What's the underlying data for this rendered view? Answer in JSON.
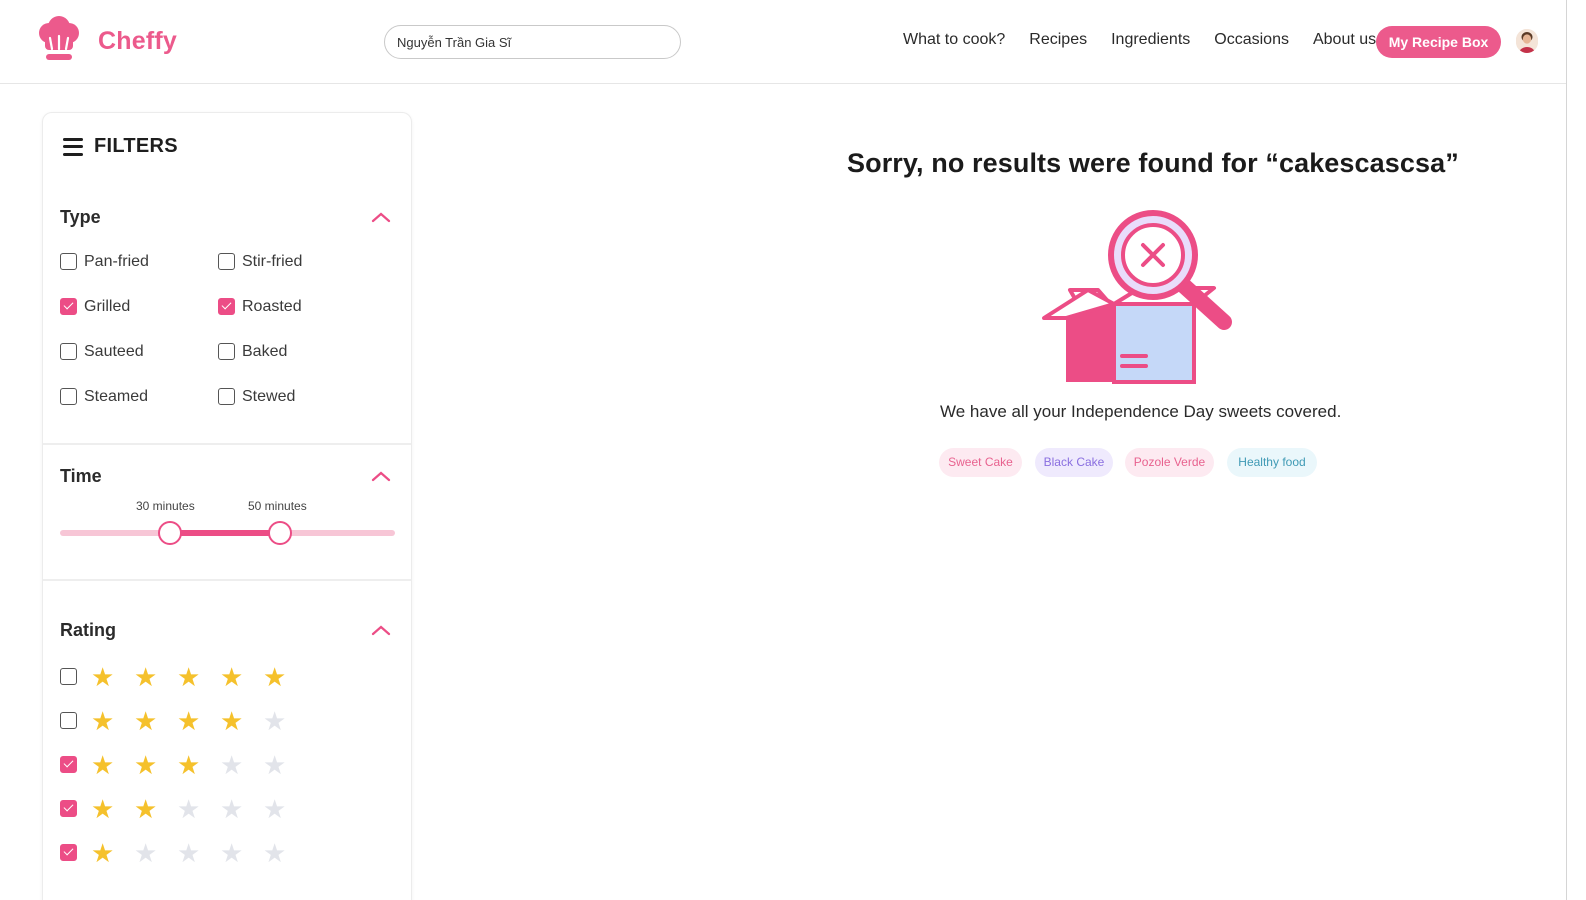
{
  "app": {
    "name": "Cheffy",
    "brand_color": "#ec5a8c"
  },
  "header": {
    "search_value": "Nguyễn Trần Gia Sĩ",
    "nav": [
      "What to cook?",
      "Recipes",
      "Ingredients",
      "Occasions",
      "About us"
    ],
    "cta_label": "My Recipe Box",
    "logo_icon": "chef-hat-icon",
    "avatar_icon": "user-avatar"
  },
  "sidebar": {
    "title": "FILTERS",
    "type": {
      "title": "Type",
      "options": [
        {
          "label": "Pan-fried",
          "checked": false
        },
        {
          "label": "Stir-fried",
          "checked": false
        },
        {
          "label": "Grilled",
          "checked": true
        },
        {
          "label": "Roasted",
          "checked": true
        },
        {
          "label": "Sauteed",
          "checked": false
        },
        {
          "label": "Baked",
          "checked": false
        },
        {
          "label": "Steamed",
          "checked": false
        },
        {
          "label": "Stewed",
          "checked": false
        }
      ]
    },
    "time": {
      "title": "Time",
      "min_label": "30 minutes",
      "max_label": "50 minutes",
      "min_value_fraction": 0.33,
      "max_value_fraction": 0.66
    },
    "rating": {
      "title": "Rating",
      "rows": [
        {
          "stars": 5,
          "checked": false
        },
        {
          "stars": 4,
          "checked": false
        },
        {
          "stars": 3,
          "checked": true
        },
        {
          "stars": 2,
          "checked": true
        },
        {
          "stars": 1,
          "checked": true
        }
      ],
      "star_color": "#f5c12c"
    }
  },
  "main": {
    "headline": "Sorry, no results were found for “cakescascsa”",
    "illustration_icon": "empty-box-magnifier-icon",
    "subtext": "We have all your Independence Day sweets covered.",
    "tags": [
      {
        "label": "Sweet Cake",
        "bg": "#fdeaf1",
        "fg": "#e8628f"
      },
      {
        "label": "Black Cake",
        "bg": "#efeafd",
        "fg": "#8a6fe0"
      },
      {
        "label": "Pozole Verde",
        "bg": "#fdeaf1",
        "fg": "#e8628f"
      },
      {
        "label": "Healthy food",
        "bg": "#eaf7fb",
        "fg": "#3f9ab5"
      }
    ]
  }
}
